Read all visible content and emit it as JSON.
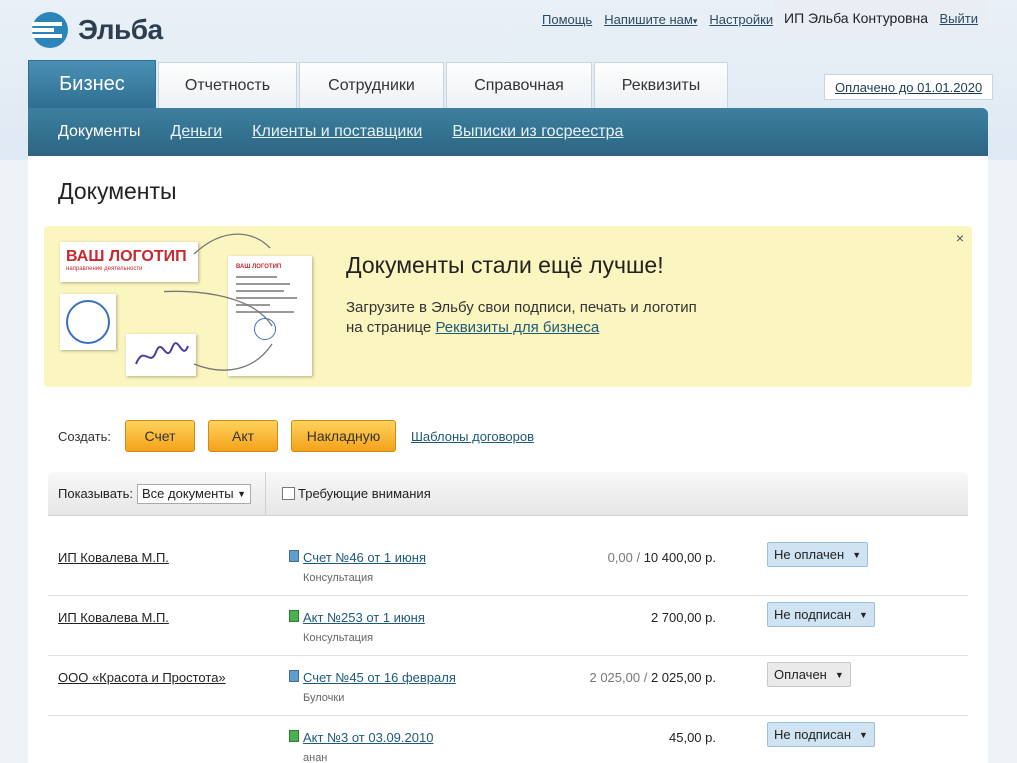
{
  "brand": {
    "name": "Эльба"
  },
  "top_links": [
    "Помощь",
    "Напишите нам",
    "Настройки"
  ],
  "user": {
    "name": "ИП Эльба Контуровна",
    "logout": "Выйти"
  },
  "tabs": [
    {
      "label": "Бизнес",
      "active": true
    },
    {
      "label": "Отчетность"
    },
    {
      "label": "Сотрудники"
    },
    {
      "label": "Справочная"
    },
    {
      "label": "Реквизиты"
    }
  ],
  "paid_until": "Оплачено до 01.01.2020",
  "subnav": [
    "Документы",
    "Деньги",
    "Клиенты и поставщики",
    "Выписки из госреестра"
  ],
  "page_title": "Документы",
  "promo": {
    "title": "Документы стали ещё лучше!",
    "text": "Загрузите в Эльбу свои подписи, печать и логотип на странице",
    "link": "Реквизиты для бизнеса",
    "close": "×",
    "logo_big": "ВАШ ЛОГОТИП",
    "logo_small": "направление деятельности",
    "doc_logo": "ВАШ ЛОГОТИП"
  },
  "create": {
    "label": "Создать:",
    "buttons": [
      "Счет",
      "Акт",
      "Накладную"
    ],
    "templates": "Шаблоны договоров"
  },
  "filter": {
    "show_label": "Показывать:",
    "show_value": "Все документы",
    "attention_label": "Требующие внимания"
  },
  "rows": [
    {
      "client": "ИП Ковалева М.П.",
      "doc": "Счет №46 от 1 июня",
      "sub": "Консультация",
      "paid_part": "0,00 / ",
      "amount": "10 400,00 р.",
      "status": "Не оплачен",
      "kind": "invoice"
    },
    {
      "client": "ИП Ковалева М.П.",
      "doc": "Акт №253 от 1 июня",
      "sub": "Консультация",
      "paid_part": "",
      "amount": "2 700,00 р.",
      "status": "Не подписан",
      "kind": "act"
    },
    {
      "client": "ООО «Красота и Простота»",
      "doc": "Счет №45 от 16 февраля",
      "sub": "Булочки",
      "paid_part": "2 025,00 / ",
      "amount": "2 025,00 р.",
      "status": "Оплачен",
      "kind": "invoice"
    },
    {
      "client": "",
      "doc": "Акт №3 от 03.09.2010",
      "sub": "анан",
      "paid_part": "",
      "amount": "45,00 р.",
      "status": "Не подписан",
      "kind": "act"
    }
  ]
}
